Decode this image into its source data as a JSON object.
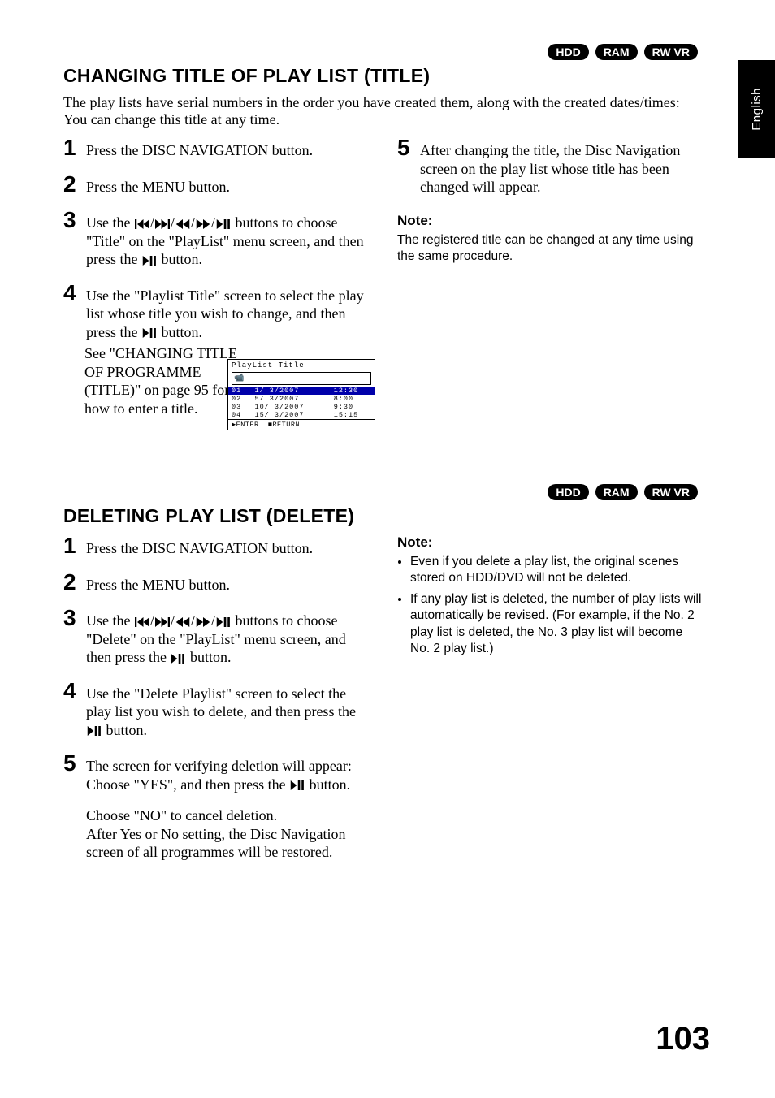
{
  "side_label": "English",
  "badges": [
    "HDD",
    "RAM",
    "RW VR"
  ],
  "sec1": {
    "title": "CHANGING TITLE OF PLAY LIST (TITLE)",
    "intro": "The play lists have serial numbers in the order you have created them, along with the created dates/times: You can change this title at any time.",
    "steps": [
      "Press the DISC NAVIGATION button.",
      "Press the MENU button.",
      "Use the {PREV}/{NEXT}/{REW}/{FF}/{PLAY} buttons to choose \"Title\" on the \"PlayList\" menu screen, and then press the {PLAY} button.",
      "Use the \"Playlist Title\" screen to select the play list whose title you wish to change, and then press the {PLAY} button.",
      "After changing the title, the Disc Navigation screen on the play list whose title has been changed will appear."
    ],
    "see": "See \"CHANGING TITLE OF PROGRAMME (TITLE)\" on page 95 for how to enter a title.",
    "shot": {
      "title": "PlayList Title",
      "rows": [
        {
          "no": "01",
          "date": " 1/ 3/2007",
          "time": "12:30"
        },
        {
          "no": "02",
          "date": " 5/ 3/2007",
          "time": " 8:00"
        },
        {
          "no": "03",
          "date": "10/ 3/2007",
          "time": " 9:30"
        },
        {
          "no": "04",
          "date": "15/ 3/2007",
          "time": "15:15"
        }
      ],
      "foot_enter": "ENTER",
      "foot_return": "RETURN"
    },
    "note_head": "Note:",
    "note": "The registered title can be changed at any time using the same procedure."
  },
  "sec2": {
    "title": "DELETING PLAY LIST (DELETE)",
    "steps": [
      "Press the DISC NAVIGATION button.",
      "Press the MENU button.",
      "Use the {PREV}/{NEXT}/{REW}/{FF}/{PLAY} buttons to choose \"Delete\" on the \"PlayList\" menu screen, and then press the {PLAY} button.",
      "Use the \"Delete Playlist\" screen to select the play list you wish to delete, and then press the {PLAY} button.",
      "The screen for verifying deletion will appear: Choose \"YES\", and then press the {PLAY} button."
    ],
    "extra": "Choose \"NO\" to cancel deletion.\nAfter Yes or No setting, the Disc Navigation screen of all programmes will be restored.",
    "note_head": "Note:",
    "notes": [
      "Even if you delete a play list, the original scenes stored on HDD/DVD will not be deleted.",
      "If any play list is deleted, the number of play lists will automatically be revised. (For example, if the No. 2 play list is deleted, the No. 3 play list will become No. 2 play list.)"
    ]
  },
  "page_number": "103"
}
